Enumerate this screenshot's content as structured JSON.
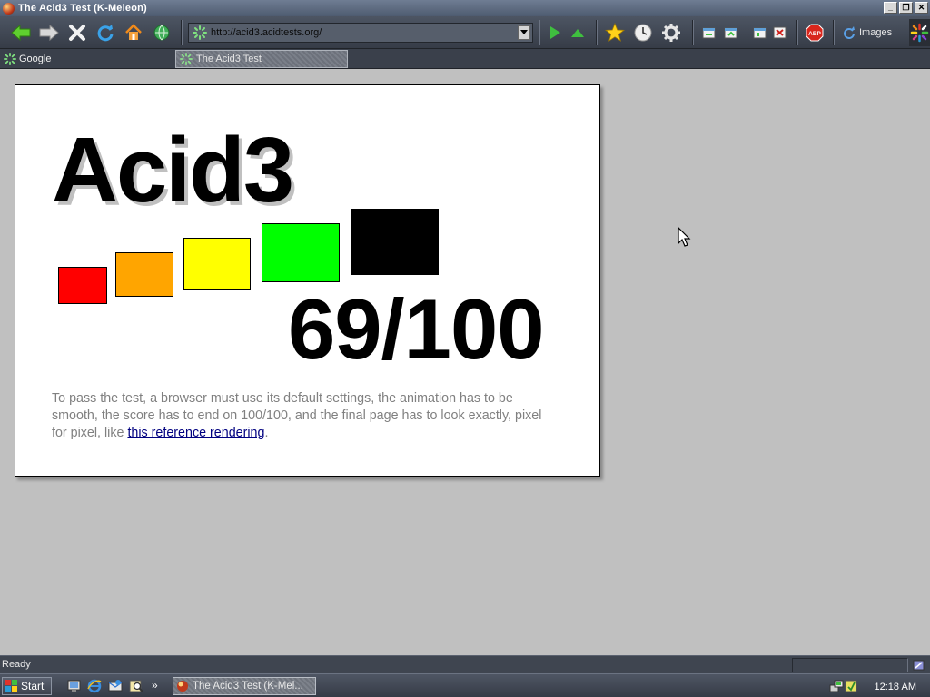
{
  "window": {
    "title": "The Acid3 Test (K-Meleon)",
    "controls": [
      "minimize",
      "restore",
      "close"
    ]
  },
  "toolbar": {
    "buttons": [
      "back-icon",
      "forward-icon",
      "stop-icon",
      "reload-icon",
      "home-icon",
      "globe-icon"
    ],
    "url": "http://acid3.acidtests.org/",
    "nav_buttons": [
      "go-icon",
      "up-icon"
    ],
    "tool_buttons": [
      "bookmarks-star-icon",
      "history-clock-icon",
      "settings-gear-icon"
    ],
    "window_buttons": [
      "page-icon-1",
      "page-icon-2",
      "page-icon-3",
      "close-page-icon"
    ],
    "adblock_label": "ABP",
    "images_label": "Images"
  },
  "tabbar": {
    "bookmarks": [
      {
        "label": "Google"
      }
    ],
    "tabs": [
      {
        "label": "The Acid3 Test",
        "active": true
      }
    ]
  },
  "acid": {
    "title": "Acid3",
    "score": "69/100",
    "box_colors": [
      "#ff0000",
      "#ffa500",
      "#ffff00",
      "#00ff00",
      "#000000"
    ],
    "desc_text": "To pass the test, a browser must use its default settings, the animation has to be smooth, the score has to end on 100/100, and the final page has to look exactly, pixel for pixel, like ",
    "desc_link": "this reference rendering",
    "desc_end": "."
  },
  "status": {
    "text": "Ready"
  },
  "taskbar": {
    "start_label": "Start",
    "quicklaunch_overflow": "»",
    "task_label": "The Acid3 Test (K-Mel...",
    "clock": "12:18 AM"
  }
}
